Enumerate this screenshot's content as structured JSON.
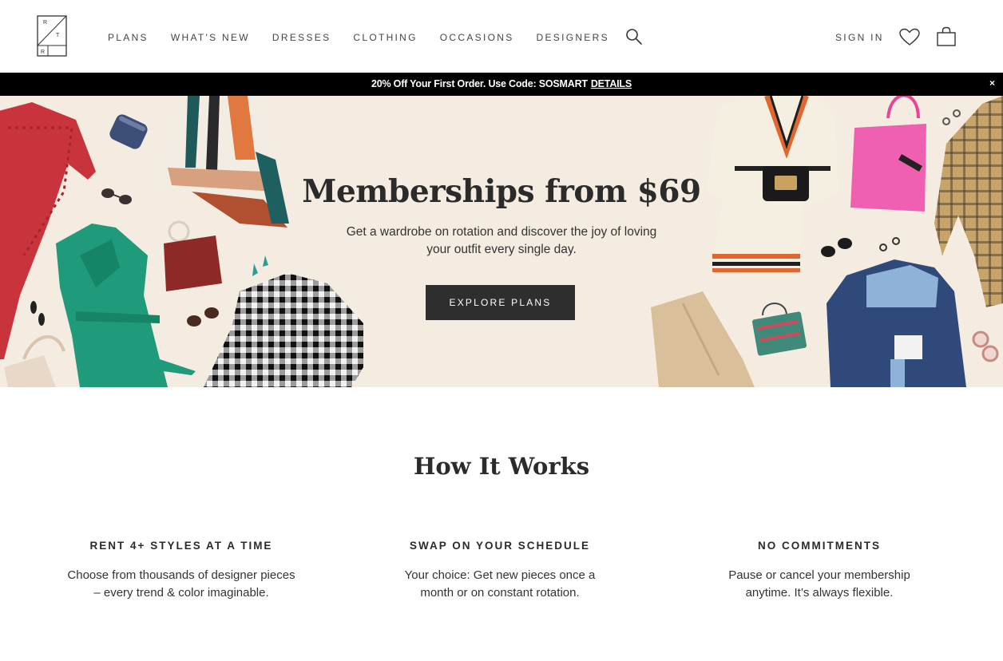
{
  "brand": {
    "logo_letters": [
      "R",
      "T",
      "R"
    ]
  },
  "nav": {
    "items": [
      "PLANS",
      "WHAT'S NEW",
      "DRESSES",
      "CLOTHING",
      "OCCASIONS",
      "DESIGNERS"
    ],
    "search_icon": "search-icon",
    "sign_in": "SIGN IN",
    "wishlist_icon": "heart-icon",
    "bag_icon": "shopping-bag-icon"
  },
  "promo": {
    "text": "20% Off Your First Order. Use Code: SOSMART",
    "link": "DETAILS",
    "close": "×"
  },
  "hero": {
    "title": "Memberships from $69",
    "subtitle": "Get a wardrobe on rotation and discover the joy of loving your outfit every single day.",
    "cta": "EXPLORE PLANS"
  },
  "how_it_works": {
    "title": "How It Works",
    "steps": [
      {
        "title": "RENT 4+ STYLES AT A TIME",
        "desc": "Choose from thousands of designer pieces – every trend & color imaginable."
      },
      {
        "title": "SWAP ON YOUR SCHEDULE",
        "desc": "Your choice: Get new pieces once a month or on constant rotation."
      },
      {
        "title": "NO COMMITMENTS",
        "desc": "Pause or cancel your membership anytime. It’s always flexible."
      }
    ]
  },
  "colors": {
    "promo_bg": "#000000",
    "hero_bg": "#f4ece0",
    "cta_bg": "#2e2e2e",
    "text": "#2b2b2b"
  }
}
